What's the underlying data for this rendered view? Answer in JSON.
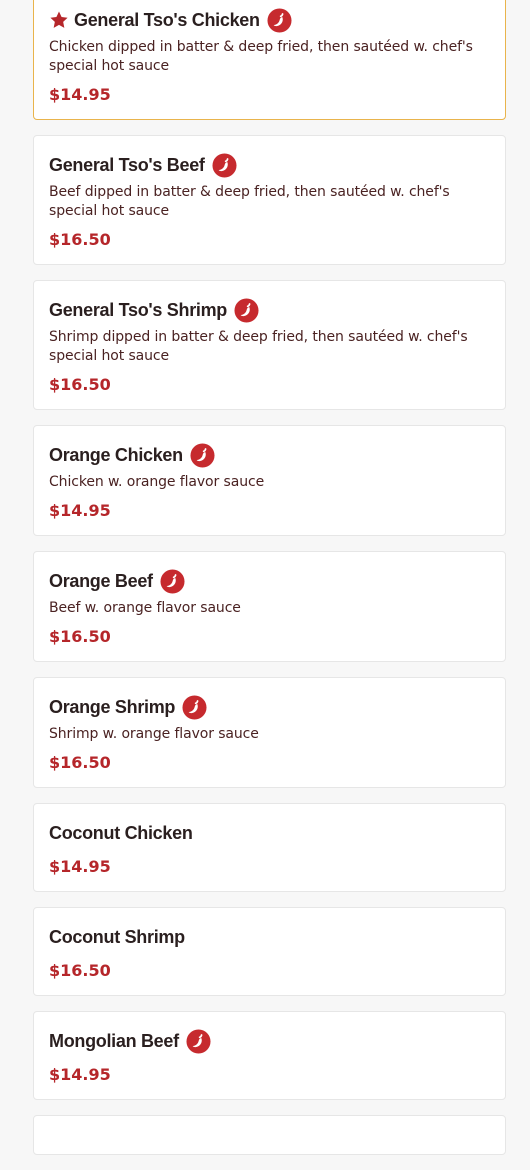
{
  "colors": {
    "price": "#b5262a",
    "spicy_badge": "#c62a2e",
    "featured_border": "#e9b44c",
    "title": "#2a1f1f"
  },
  "menu": {
    "items": [
      {
        "name": "General Tso's Chicken",
        "description": "Chicken dipped in batter & deep fried, then sautéed w. chef's special hot sauce",
        "price": "$14.95",
        "spicy": true,
        "featured": true,
        "icon": "star-icon"
      },
      {
        "name": "General Tso's Beef",
        "description": "Beef dipped in batter & deep fried, then sautéed w. chef's special hot sauce",
        "price": "$16.50",
        "spicy": true,
        "featured": false
      },
      {
        "name": "General Tso's Shrimp",
        "description": "Shrimp dipped in batter & deep fried, then sautéed w. chef's special hot sauce",
        "price": "$16.50",
        "spicy": true,
        "featured": false
      },
      {
        "name": "Orange Chicken",
        "description": "Chicken w. orange flavor sauce",
        "price": "$14.95",
        "spicy": true,
        "featured": false
      },
      {
        "name": "Orange Beef",
        "description": "Beef w. orange flavor sauce",
        "price": "$16.50",
        "spicy": true,
        "featured": false
      },
      {
        "name": "Orange Shrimp",
        "description": "Shrimp w. orange flavor sauce",
        "price": "$16.50",
        "spicy": true,
        "featured": false
      },
      {
        "name": "Coconut Chicken",
        "description": "",
        "price": "$14.95",
        "spicy": false,
        "featured": false
      },
      {
        "name": "Coconut Shrimp",
        "description": "",
        "price": "$16.50",
        "spicy": false,
        "featured": false
      },
      {
        "name": "Mongolian Beef",
        "description": "",
        "price": "$14.95",
        "spicy": true,
        "featured": false
      }
    ]
  }
}
